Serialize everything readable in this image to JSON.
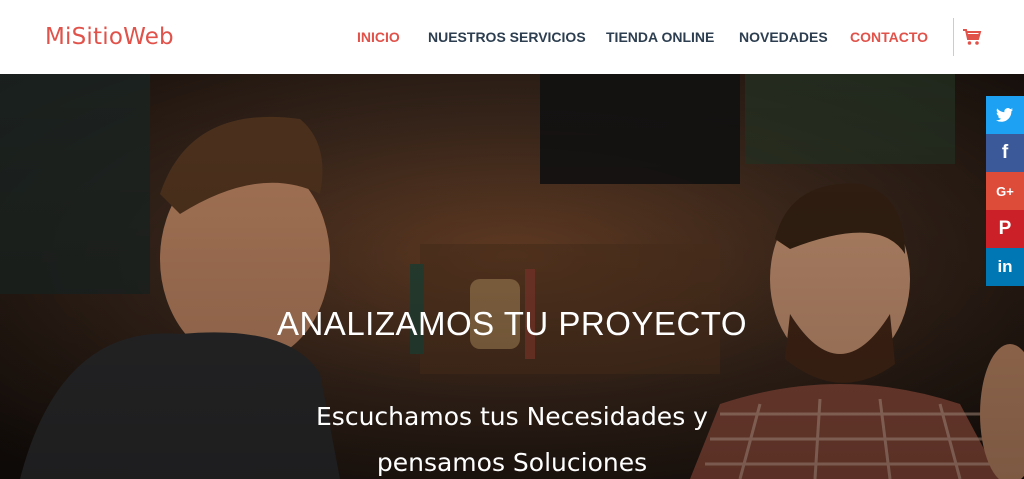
{
  "site": {
    "logo": "MiSitioWeb"
  },
  "nav": {
    "items": [
      {
        "label": "INICIO"
      },
      {
        "label": "NUESTROS SERVICIOS"
      },
      {
        "label": "TIENDA ONLINE"
      },
      {
        "label": "NOVEDADES"
      },
      {
        "label": "CONTACTO"
      }
    ]
  },
  "colors": {
    "accent": "#e0524a",
    "nav_text": "#2c3e50",
    "twitter": "#1da1f2",
    "facebook": "#3b5998",
    "googleplus": "#dd4b39",
    "pinterest": "#cb2027",
    "linkedin": "#0077b5"
  },
  "icons": {
    "cart": "shopping-cart-icon",
    "twitter": "twitter-icon",
    "facebook": "facebook-icon",
    "googleplus": "google-plus-icon",
    "pinterest": "pinterest-icon",
    "linkedin": "linkedin-icon"
  },
  "hero": {
    "title": "ANALIZAMOS TU PROYECTO",
    "subtitle_line1": "Escuchamos tus Necesidades y",
    "subtitle_line2": "pensamos Soluciones"
  },
  "social": {
    "twitter": "",
    "facebook": "f",
    "googleplus": "G+",
    "pinterest": "P",
    "linkedin": "in"
  }
}
